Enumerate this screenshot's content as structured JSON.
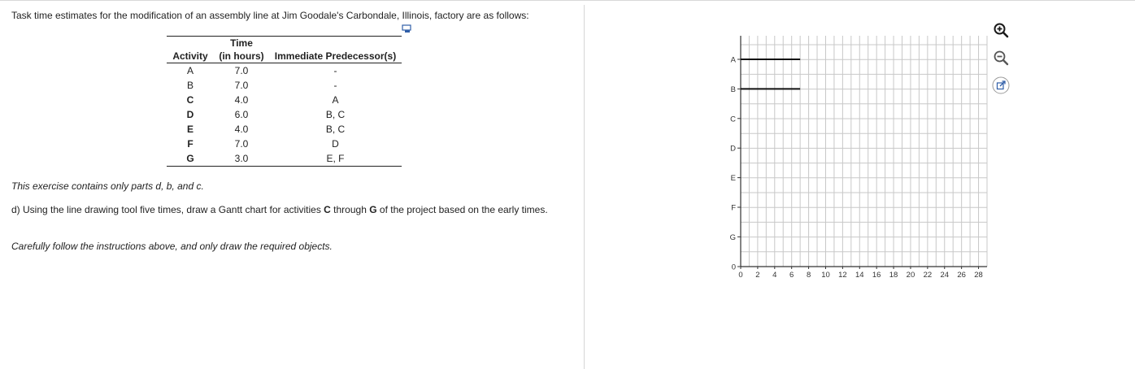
{
  "question": {
    "intro": "Task time estimates for the modification of an assembly line at Jim Goodale's Carbondale, Illinois, factory are as follows:",
    "table": {
      "headers": {
        "activity": "Activity",
        "time_top": "Time",
        "time_bottom": "(in hours)",
        "predecessor": "Immediate Predecessor(s)"
      },
      "rows": [
        {
          "activity": "A",
          "time": "7.0",
          "pred": "-"
        },
        {
          "activity": "B",
          "time": "7.0",
          "pred": "-"
        },
        {
          "activity": "C",
          "time": "4.0",
          "pred": "A"
        },
        {
          "activity": "D",
          "time": "6.0",
          "pred": "B, C"
        },
        {
          "activity": "E",
          "time": "4.0",
          "pred": "B, C"
        },
        {
          "activity": "F",
          "time": "7.0",
          "pred": "D"
        },
        {
          "activity": "G",
          "time": "3.0",
          "pred": "E, F"
        }
      ]
    },
    "note": "This exercise contains only parts d, b, and c.",
    "part_d": {
      "before": "d) Using the line drawing tool five times, draw a Gantt chart for activities ",
      "bold1": "C",
      "middle": " through ",
      "bold2": "G",
      "after": " of the project based on the early times."
    },
    "instruction": "Carefully follow the instructions above, and only draw the required objects."
  },
  "chart_data": {
    "type": "bar",
    "categories": [
      "A",
      "B",
      "C",
      "D",
      "E",
      "F",
      "G"
    ],
    "y_extra_tick": "0",
    "x_ticks": [
      "0",
      "2",
      "4",
      "6",
      "8",
      "10",
      "12",
      "14",
      "16",
      "18",
      "20",
      "22",
      "24",
      "26",
      "28"
    ],
    "xlim": [
      0,
      29
    ],
    "grid": true,
    "bars": [
      {
        "activity": "A",
        "start": 0,
        "end": 7
      },
      {
        "activity": "B",
        "start": 0,
        "end": 7
      }
    ],
    "colors": {
      "bar": "#111111",
      "grid": "#c8c8c8",
      "axis": "#333333"
    }
  },
  "tools": {
    "zoom_in": "zoom-in-icon",
    "zoom_out": "zoom-out-icon",
    "popout": "popout-icon"
  }
}
